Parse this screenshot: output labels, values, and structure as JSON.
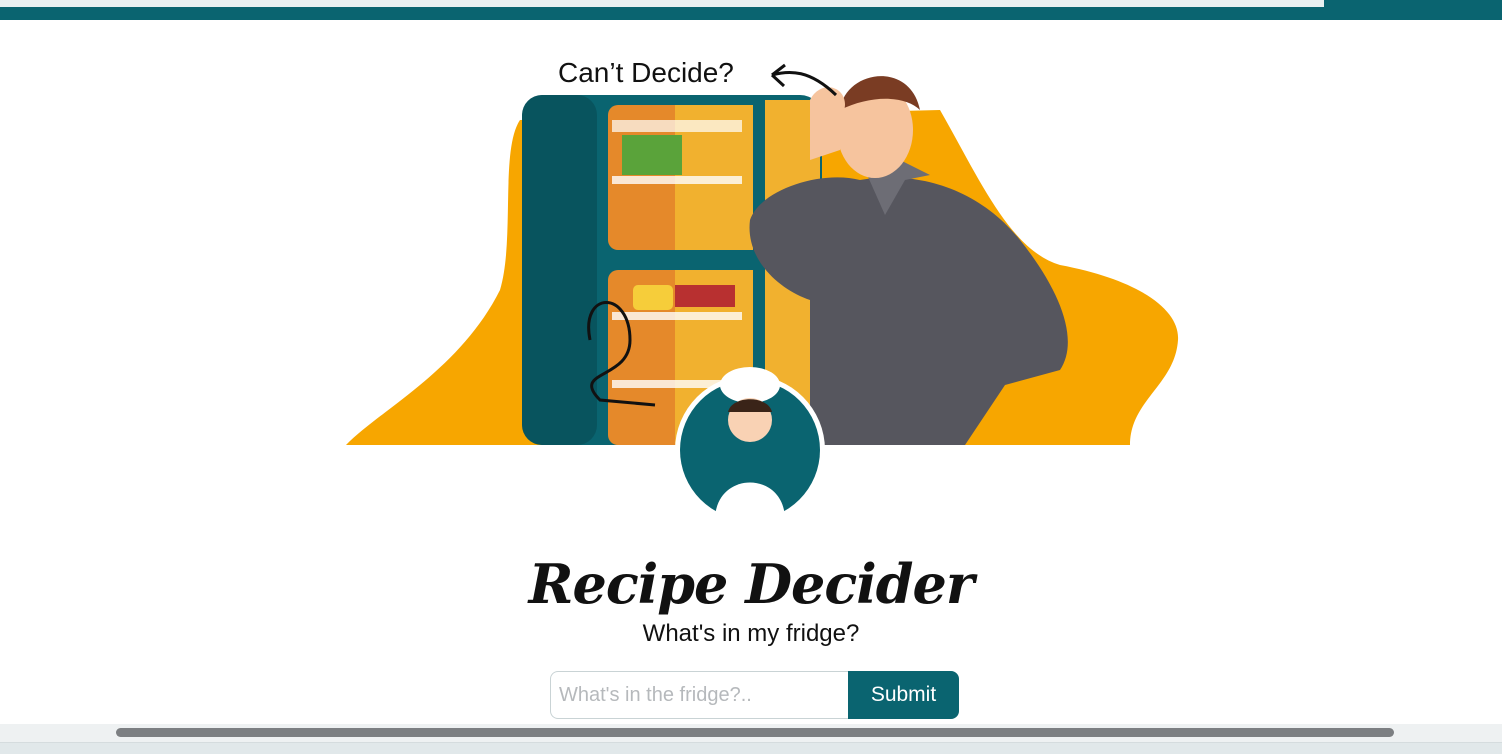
{
  "colors": {
    "teal": "#0a6470",
    "orange": "#f7a600",
    "shirt": "#56565e"
  },
  "hero": {
    "speech_text": "Can’t Decide?"
  },
  "app": {
    "title": "Recipe Decider",
    "subtitle": "What's in my fridge?"
  },
  "search": {
    "placeholder": "What's in the fridge?..",
    "value": "",
    "submit_label": "Submit"
  }
}
